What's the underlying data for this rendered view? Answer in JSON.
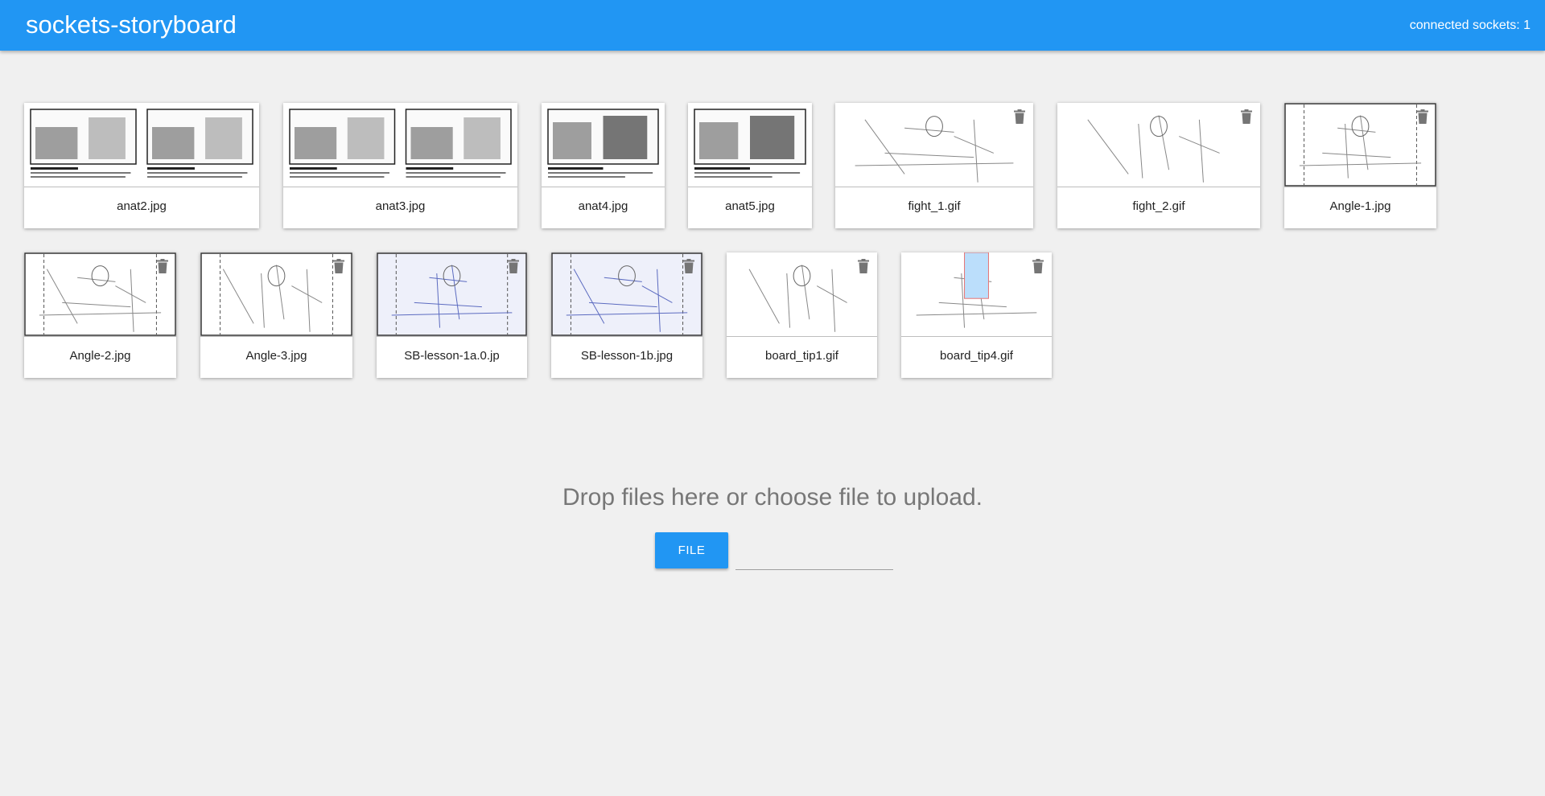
{
  "header": {
    "title": "sockets-storyboard",
    "status": "connected sockets: 1"
  },
  "colors": {
    "primary": "#2196f3",
    "background": "#f0f0f0",
    "icon": "#757575"
  },
  "files": [
    {
      "name": "anat2.jpg",
      "has_delete": false,
      "thumbnail": "storyboard-panels"
    },
    {
      "name": "anat3.jpg",
      "has_delete": false,
      "thumbnail": "storyboard-panels"
    },
    {
      "name": "anat4.jpg",
      "has_delete": false,
      "thumbnail": "storyboard-panel"
    },
    {
      "name": "anat5.jpg",
      "has_delete": false,
      "thumbnail": "storyboard-panel"
    },
    {
      "name": "fight_1.gif",
      "has_delete": true,
      "thumbnail": "sketch"
    },
    {
      "name": "fight_2.gif",
      "has_delete": true,
      "thumbnail": "sketch"
    },
    {
      "name": "Angle-1.jpg",
      "has_delete": true,
      "thumbnail": "sketch"
    },
    {
      "name": "Angle-2.jpg",
      "has_delete": true,
      "thumbnail": "sketch"
    },
    {
      "name": "Angle-3.jpg",
      "has_delete": true,
      "thumbnail": "sketch"
    },
    {
      "name": "SB-lesson-1a.0.jp",
      "has_delete": true,
      "thumbnail": "sketch"
    },
    {
      "name": "SB-lesson-1b.jpg",
      "has_delete": true,
      "thumbnail": "sketch"
    },
    {
      "name": "board_tip1.gif",
      "has_delete": true,
      "thumbnail": "sketch"
    },
    {
      "name": "board_tip4.gif",
      "has_delete": true,
      "thumbnail": "sketch"
    }
  ],
  "upload": {
    "prompt": "Drop files here or choose file to upload.",
    "button_label": "FILE",
    "file_path_value": ""
  }
}
